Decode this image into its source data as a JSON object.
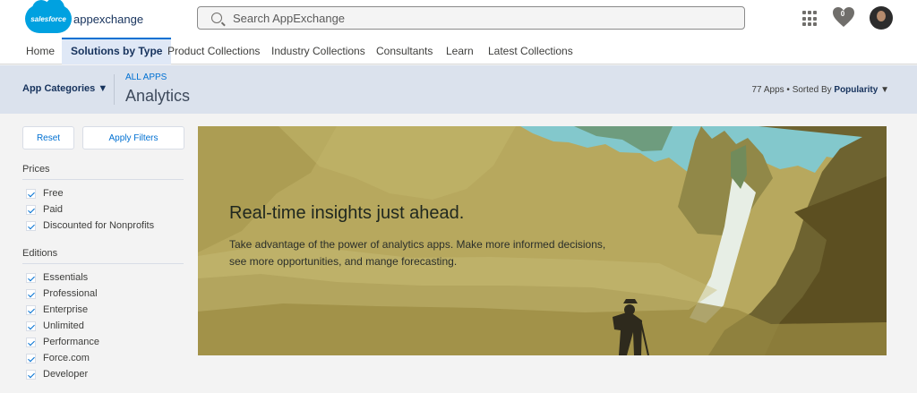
{
  "app": {
    "logo_small": "salesforce",
    "logo_text": "appexchange",
    "brand_color": "#00a1e0"
  },
  "search": {
    "placeholder": "Search AppExchange"
  },
  "header": {
    "favorites_count": "0",
    "icons": [
      "grid-icon",
      "heart-icon",
      "avatar"
    ]
  },
  "navigation": {
    "tabs": [
      {
        "label": "Home"
      },
      {
        "label": "Solutions by Type",
        "active": true
      },
      {
        "label": "Product Collections"
      },
      {
        "label": "Industry Collections"
      },
      {
        "label": "Consultants"
      },
      {
        "label": "Learn"
      },
      {
        "label": "Latest Collections"
      }
    ]
  },
  "category": {
    "dropdown_label": "App Categories",
    "breadcrumb": "ALL APPS",
    "title": "Analytics",
    "count_text": "77 Apps • Sorted By",
    "sort_value": "Popularity"
  },
  "filters": {
    "reset_label": "Reset",
    "apply_label": "Apply Filters",
    "prices_title": "Prices",
    "prices": [
      "Free",
      "Paid",
      "Discounted for Nonprofits"
    ],
    "editions_title": "Editions",
    "editions": [
      "Essentials",
      "Professional",
      "Enterprise",
      "Unlimited",
      "Performance",
      "Force.com",
      "Developer"
    ]
  },
  "hero": {
    "title": "Real-time insights just ahead.",
    "body": "Take advantage of the power of analytics apps. Make more informed decisions, see more opportunities, and mange forecasting.",
    "colors": {
      "sky": "#83c8cc",
      "rock": "#b7a85e",
      "dark": "#5c4f21"
    }
  }
}
